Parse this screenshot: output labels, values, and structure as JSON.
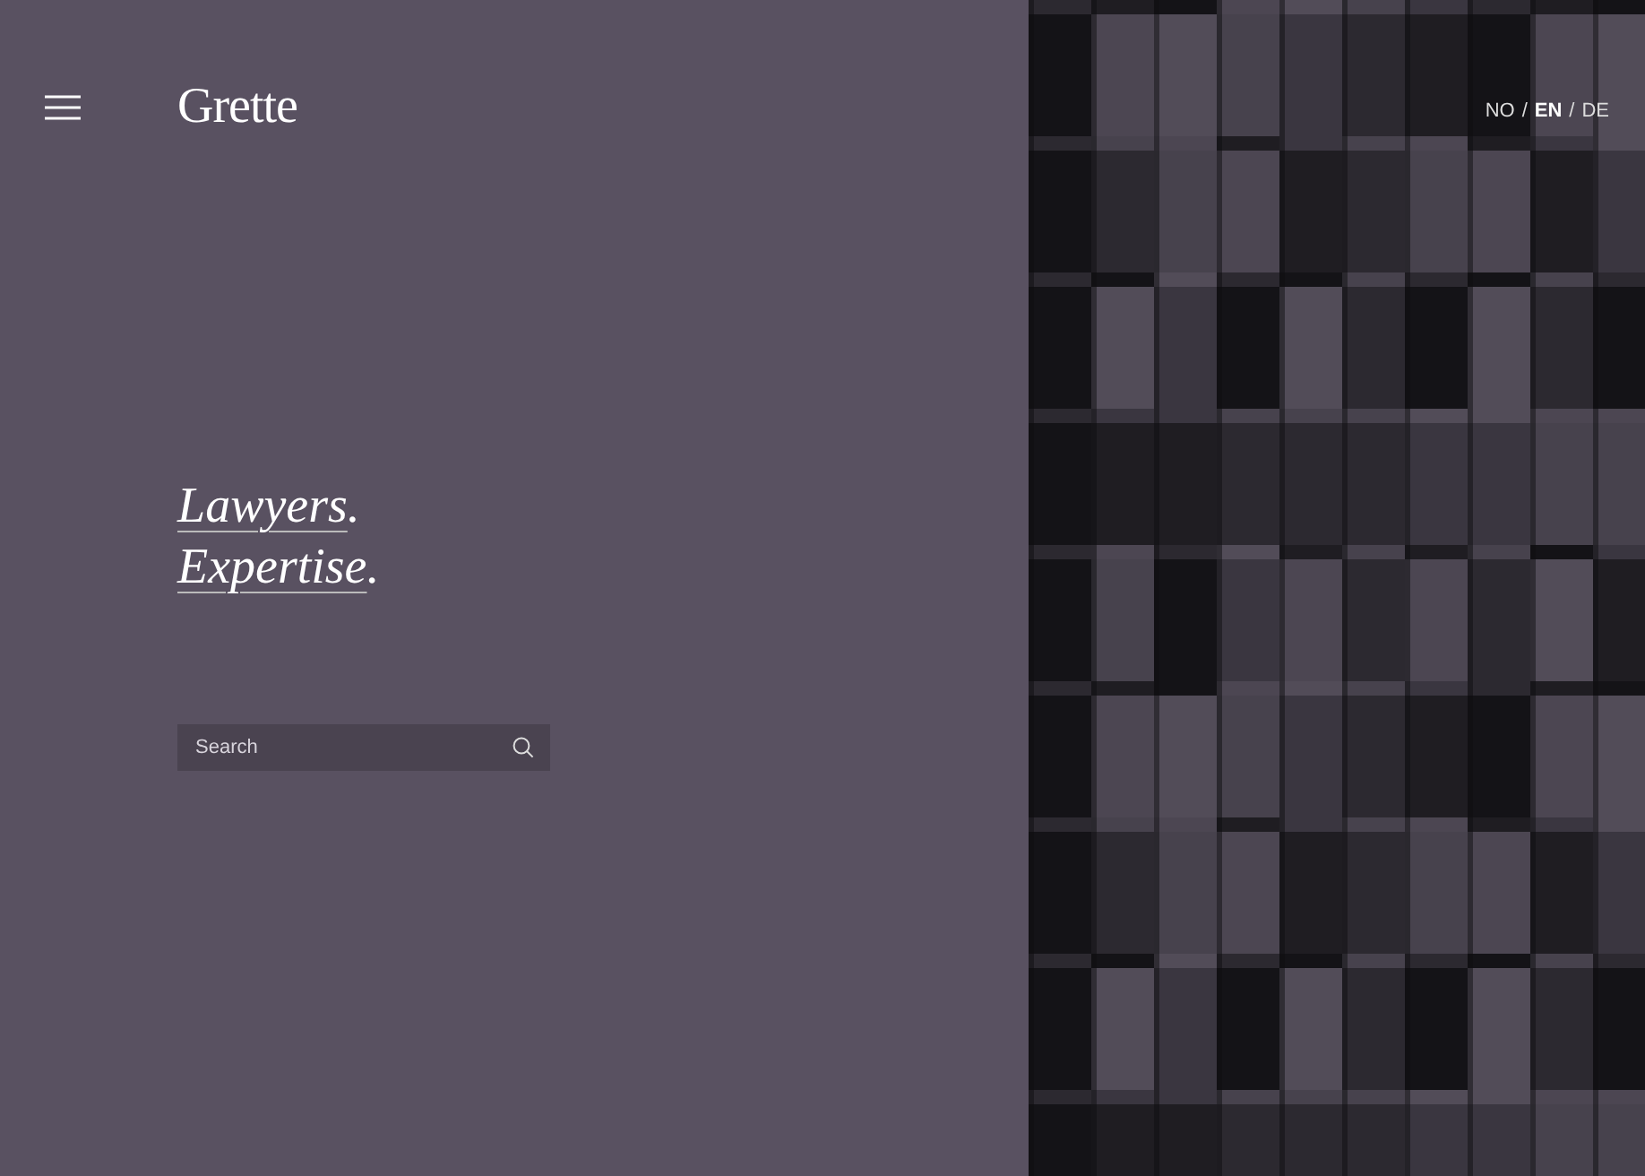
{
  "header": {
    "logo": "Grette"
  },
  "languages": [
    {
      "label": "NO",
      "selected": false
    },
    {
      "label": "EN",
      "selected": true
    },
    {
      "label": "DE",
      "selected": false
    }
  ],
  "language_separators": [
    "/",
    "/"
  ],
  "headline": [
    {
      "label": "Lawyers",
      "suffix": "."
    },
    {
      "label": "Expertise",
      "suffix": "."
    }
  ],
  "search": {
    "placeholder": "Search"
  }
}
